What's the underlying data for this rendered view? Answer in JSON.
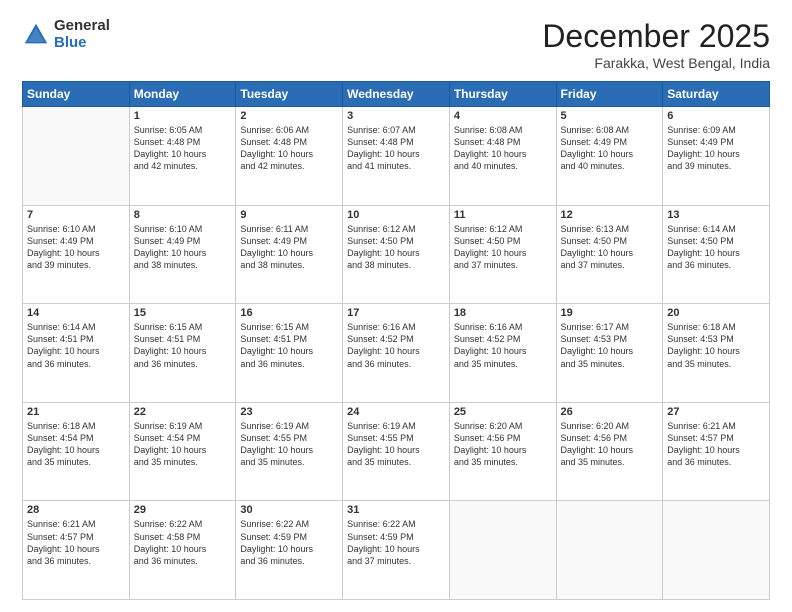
{
  "header": {
    "logo_general": "General",
    "logo_blue": "Blue",
    "title": "December 2025",
    "location": "Farakka, West Bengal, India"
  },
  "weekdays": [
    "Sunday",
    "Monday",
    "Tuesday",
    "Wednesday",
    "Thursday",
    "Friday",
    "Saturday"
  ],
  "weeks": [
    [
      {
        "day": "",
        "info": ""
      },
      {
        "day": "1",
        "info": "Sunrise: 6:05 AM\nSunset: 4:48 PM\nDaylight: 10 hours\nand 42 minutes."
      },
      {
        "day": "2",
        "info": "Sunrise: 6:06 AM\nSunset: 4:48 PM\nDaylight: 10 hours\nand 42 minutes."
      },
      {
        "day": "3",
        "info": "Sunrise: 6:07 AM\nSunset: 4:48 PM\nDaylight: 10 hours\nand 41 minutes."
      },
      {
        "day": "4",
        "info": "Sunrise: 6:08 AM\nSunset: 4:48 PM\nDaylight: 10 hours\nand 40 minutes."
      },
      {
        "day": "5",
        "info": "Sunrise: 6:08 AM\nSunset: 4:49 PM\nDaylight: 10 hours\nand 40 minutes."
      },
      {
        "day": "6",
        "info": "Sunrise: 6:09 AM\nSunset: 4:49 PM\nDaylight: 10 hours\nand 39 minutes."
      }
    ],
    [
      {
        "day": "7",
        "info": "Sunrise: 6:10 AM\nSunset: 4:49 PM\nDaylight: 10 hours\nand 39 minutes."
      },
      {
        "day": "8",
        "info": "Sunrise: 6:10 AM\nSunset: 4:49 PM\nDaylight: 10 hours\nand 38 minutes."
      },
      {
        "day": "9",
        "info": "Sunrise: 6:11 AM\nSunset: 4:49 PM\nDaylight: 10 hours\nand 38 minutes."
      },
      {
        "day": "10",
        "info": "Sunrise: 6:12 AM\nSunset: 4:50 PM\nDaylight: 10 hours\nand 38 minutes."
      },
      {
        "day": "11",
        "info": "Sunrise: 6:12 AM\nSunset: 4:50 PM\nDaylight: 10 hours\nand 37 minutes."
      },
      {
        "day": "12",
        "info": "Sunrise: 6:13 AM\nSunset: 4:50 PM\nDaylight: 10 hours\nand 37 minutes."
      },
      {
        "day": "13",
        "info": "Sunrise: 6:14 AM\nSunset: 4:50 PM\nDaylight: 10 hours\nand 36 minutes."
      }
    ],
    [
      {
        "day": "14",
        "info": "Sunrise: 6:14 AM\nSunset: 4:51 PM\nDaylight: 10 hours\nand 36 minutes."
      },
      {
        "day": "15",
        "info": "Sunrise: 6:15 AM\nSunset: 4:51 PM\nDaylight: 10 hours\nand 36 minutes."
      },
      {
        "day": "16",
        "info": "Sunrise: 6:15 AM\nSunset: 4:51 PM\nDaylight: 10 hours\nand 36 minutes."
      },
      {
        "day": "17",
        "info": "Sunrise: 6:16 AM\nSunset: 4:52 PM\nDaylight: 10 hours\nand 36 minutes."
      },
      {
        "day": "18",
        "info": "Sunrise: 6:16 AM\nSunset: 4:52 PM\nDaylight: 10 hours\nand 35 minutes."
      },
      {
        "day": "19",
        "info": "Sunrise: 6:17 AM\nSunset: 4:53 PM\nDaylight: 10 hours\nand 35 minutes."
      },
      {
        "day": "20",
        "info": "Sunrise: 6:18 AM\nSunset: 4:53 PM\nDaylight: 10 hours\nand 35 minutes."
      }
    ],
    [
      {
        "day": "21",
        "info": "Sunrise: 6:18 AM\nSunset: 4:54 PM\nDaylight: 10 hours\nand 35 minutes."
      },
      {
        "day": "22",
        "info": "Sunrise: 6:19 AM\nSunset: 4:54 PM\nDaylight: 10 hours\nand 35 minutes."
      },
      {
        "day": "23",
        "info": "Sunrise: 6:19 AM\nSunset: 4:55 PM\nDaylight: 10 hours\nand 35 minutes."
      },
      {
        "day": "24",
        "info": "Sunrise: 6:19 AM\nSunset: 4:55 PM\nDaylight: 10 hours\nand 35 minutes."
      },
      {
        "day": "25",
        "info": "Sunrise: 6:20 AM\nSunset: 4:56 PM\nDaylight: 10 hours\nand 35 minutes."
      },
      {
        "day": "26",
        "info": "Sunrise: 6:20 AM\nSunset: 4:56 PM\nDaylight: 10 hours\nand 35 minutes."
      },
      {
        "day": "27",
        "info": "Sunrise: 6:21 AM\nSunset: 4:57 PM\nDaylight: 10 hours\nand 36 minutes."
      }
    ],
    [
      {
        "day": "28",
        "info": "Sunrise: 6:21 AM\nSunset: 4:57 PM\nDaylight: 10 hours\nand 36 minutes."
      },
      {
        "day": "29",
        "info": "Sunrise: 6:22 AM\nSunset: 4:58 PM\nDaylight: 10 hours\nand 36 minutes."
      },
      {
        "day": "30",
        "info": "Sunrise: 6:22 AM\nSunset: 4:59 PM\nDaylight: 10 hours\nand 36 minutes."
      },
      {
        "day": "31",
        "info": "Sunrise: 6:22 AM\nSunset: 4:59 PM\nDaylight: 10 hours\nand 37 minutes."
      },
      {
        "day": "",
        "info": ""
      },
      {
        "day": "",
        "info": ""
      },
      {
        "day": "",
        "info": ""
      }
    ]
  ]
}
